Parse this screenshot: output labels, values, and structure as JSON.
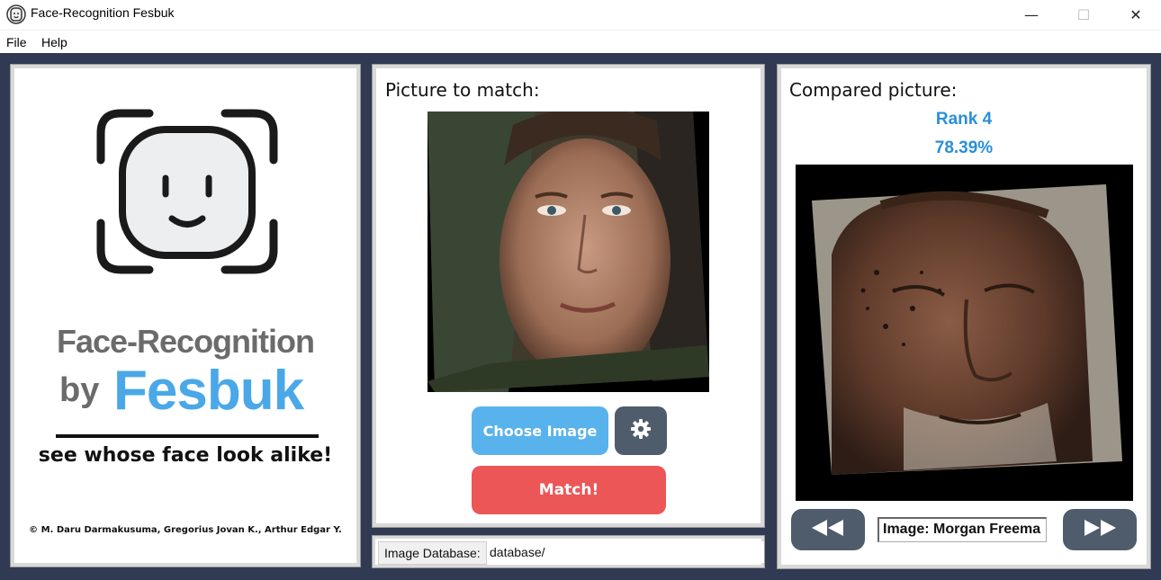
{
  "window": {
    "title": "Face-Recognition Fesbuk",
    "minimize_glyph": "—",
    "maximize_glyph": "☐",
    "close_glyph": "✕"
  },
  "menu": {
    "items": [
      {
        "label": "File"
      },
      {
        "label": "Help"
      }
    ]
  },
  "logo_panel": {
    "icon": "face-id-icon",
    "brand_line1": "Face-Recognition",
    "brand_by": "by",
    "brand_name": "Fesbuk",
    "tagline": "see whose face look alike!",
    "credits": "© M. Daru Darmakusuma, Gregorius Jovan K., Arthur Edgar Y.",
    "brand_color": "#4aa8e8"
  },
  "match_panel": {
    "title": "Picture to match:",
    "choose_button": "Choose Image",
    "settings_icon": "gear-icon",
    "match_button": "Match!",
    "choose_color": "#58b2ec",
    "match_color": "#ec5657"
  },
  "database": {
    "label": "Image Database:",
    "value": "database/"
  },
  "compare_panel": {
    "title": "Compared picture:",
    "rank": "Rank 4",
    "score": "78.39%",
    "image_name": "Image: Morgan Freema",
    "prev_icon": "rewind-icon",
    "next_icon": "fast-forward-icon",
    "accent_color": "#2a8fd8"
  }
}
